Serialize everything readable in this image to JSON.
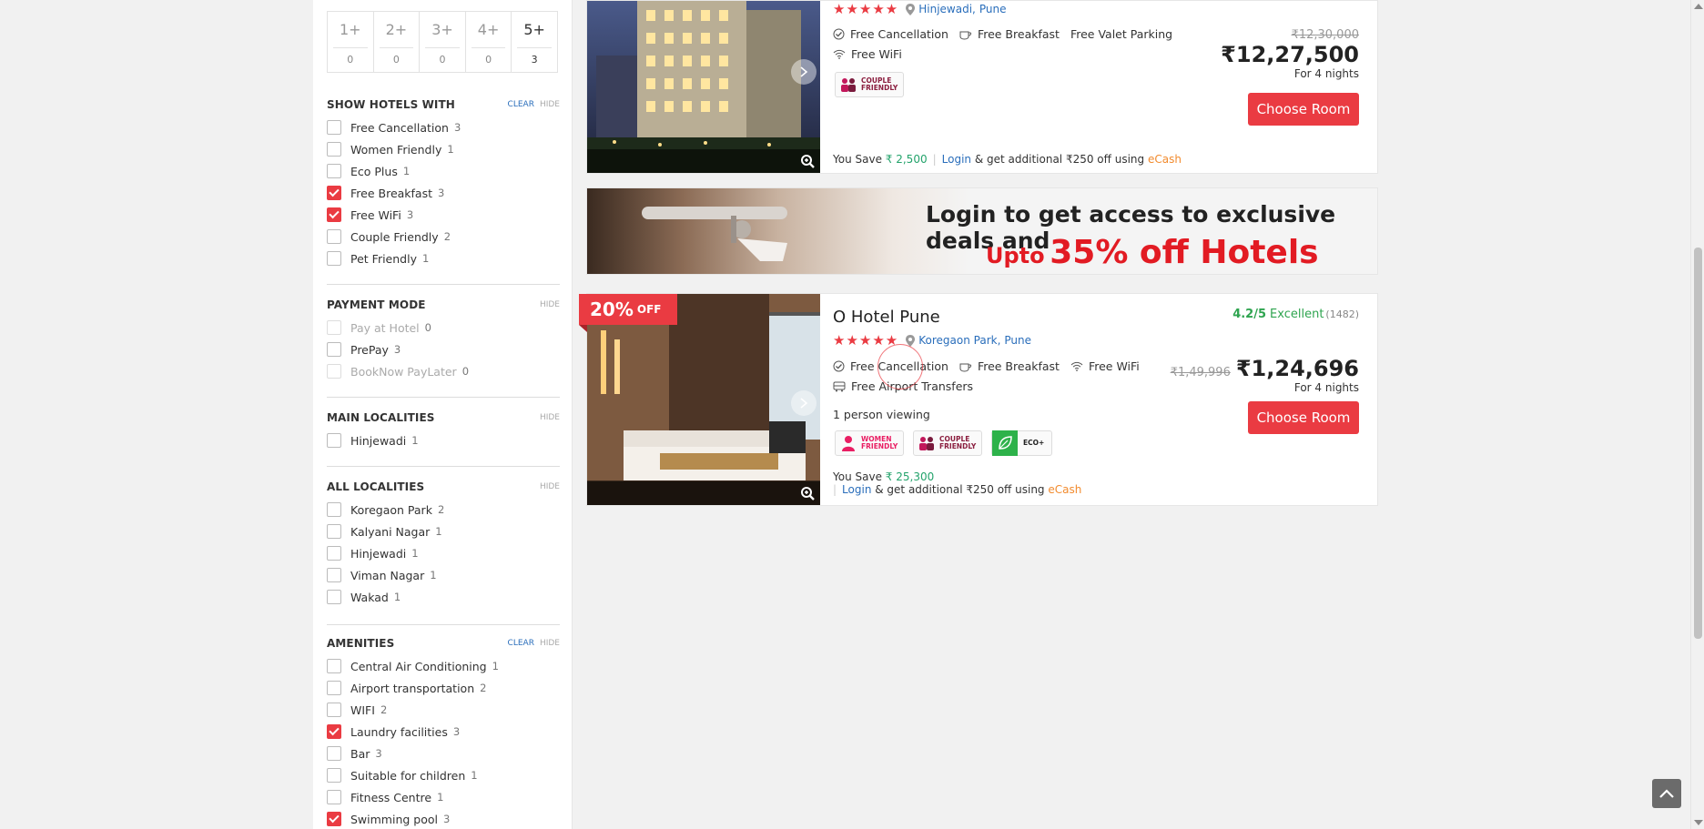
{
  "star_filter": [
    {
      "label": "1+",
      "count": "0"
    },
    {
      "label": "2+",
      "count": "0"
    },
    {
      "label": "3+",
      "count": "0"
    },
    {
      "label": "4+",
      "count": "0"
    },
    {
      "label": "5+",
      "count": "3"
    }
  ],
  "show_hotels_with": {
    "title": "SHOW HOTELS WITH",
    "clear": "CLEAR",
    "hide": "HIDE",
    "items": [
      {
        "label": "Free Cancellation",
        "count": "3",
        "checked": false
      },
      {
        "label": "Women Friendly",
        "count": "1",
        "checked": false
      },
      {
        "label": "Eco Plus",
        "count": "1",
        "checked": false
      },
      {
        "label": "Free Breakfast",
        "count": "3",
        "checked": true
      },
      {
        "label": "Free WiFi",
        "count": "3",
        "checked": true
      },
      {
        "label": "Couple Friendly",
        "count": "2",
        "checked": false
      },
      {
        "label": "Pet Friendly",
        "count": "1",
        "checked": false
      }
    ]
  },
  "payment_mode": {
    "title": "PAYMENT MODE",
    "hide": "HIDE",
    "items": [
      {
        "label": "Pay at Hotel",
        "count": "0",
        "disabled": true
      },
      {
        "label": "PrePay",
        "count": "3",
        "disabled": false
      },
      {
        "label": "BookNow PayLater",
        "count": "0",
        "disabled": true
      }
    ]
  },
  "main_localities": {
    "title": "MAIN LOCALITIES",
    "hide": "HIDE",
    "items": [
      {
        "label": "Hinjewadi",
        "count": "1"
      }
    ]
  },
  "all_localities": {
    "title": "ALL LOCALITIES",
    "hide": "HIDE",
    "items": [
      {
        "label": "Koregaon Park",
        "count": "2"
      },
      {
        "label": "Kalyani Nagar",
        "count": "1"
      },
      {
        "label": "Hinjewadi",
        "count": "1"
      },
      {
        "label": "Viman Nagar",
        "count": "1"
      },
      {
        "label": "Wakad",
        "count": "1"
      }
    ]
  },
  "amenities": {
    "title": "AMENITIES",
    "clear": "CLEAR",
    "hide": "HIDE",
    "items": [
      {
        "label": "Central Air Conditioning",
        "count": "1",
        "checked": false
      },
      {
        "label": "Airport transportation",
        "count": "2",
        "checked": false
      },
      {
        "label": "WIFI",
        "count": "2",
        "checked": false
      },
      {
        "label": "Laundry facilities",
        "count": "3",
        "checked": true
      },
      {
        "label": "Bar",
        "count": "3",
        "checked": false
      },
      {
        "label": "Suitable for children",
        "count": "1",
        "checked": false
      },
      {
        "label": "Fitness Centre",
        "count": "1",
        "checked": false
      },
      {
        "label": "Swimming pool",
        "count": "3",
        "checked": true
      }
    ]
  },
  "hotel1": {
    "stars": "★★★★★",
    "locality": "Hinjewadi,",
    "city": "Pune",
    "amenities": [
      "Free Cancellation",
      "Free Breakfast",
      "Free Valet Parking"
    ],
    "amenities2": [
      "Free WiFi"
    ],
    "badge": "COUPLE FRIENDLY",
    "old_price": "₹12,30,000",
    "price": "₹12,27,500",
    "nights": "For 4 nights",
    "cta": "Choose Room",
    "save_label": "You Save",
    "save_amount": "₹ 2,500",
    "login": "Login",
    "save_tail": "& get additional ₹250 off using",
    "ecash": "eCash"
  },
  "banner": {
    "line1": "Login to get access to exclusive deals and",
    "line2_small": "Upto",
    "line2_big": "35% off Hotels"
  },
  "hotel2": {
    "discount_pct": "20%",
    "discount_off": "OFF",
    "name": "O Hotel Pune",
    "stars": "★★★★★",
    "locality": "Koregaon Park,",
    "city": "Pune",
    "rating_score": "4.2/5",
    "rating_word": "Excellent",
    "reviews": "(1482)",
    "amenities": [
      "Free Cancellation",
      "Free Breakfast",
      "Free WiFi"
    ],
    "amenities2": [
      "Free Airport Transfers"
    ],
    "viewing": "1 person viewing",
    "badges": [
      "WOMEN FRIENDLY",
      "COUPLE FRIENDLY",
      "ECO+"
    ],
    "old_price": "₹1,49,996",
    "price": "₹1,24,696",
    "nights": "For 4 nights",
    "cta": "Choose Room",
    "save_label": "You Save",
    "save_amount": "₹ 25,300",
    "login": "Login",
    "save_tail": "& get additional ₹250 off using",
    "ecash": "eCash"
  },
  "colors": {
    "accent": "#ea3b42",
    "link": "#2a6ebb",
    "green": "#23a36b",
    "ecash": "#f28b2e"
  }
}
